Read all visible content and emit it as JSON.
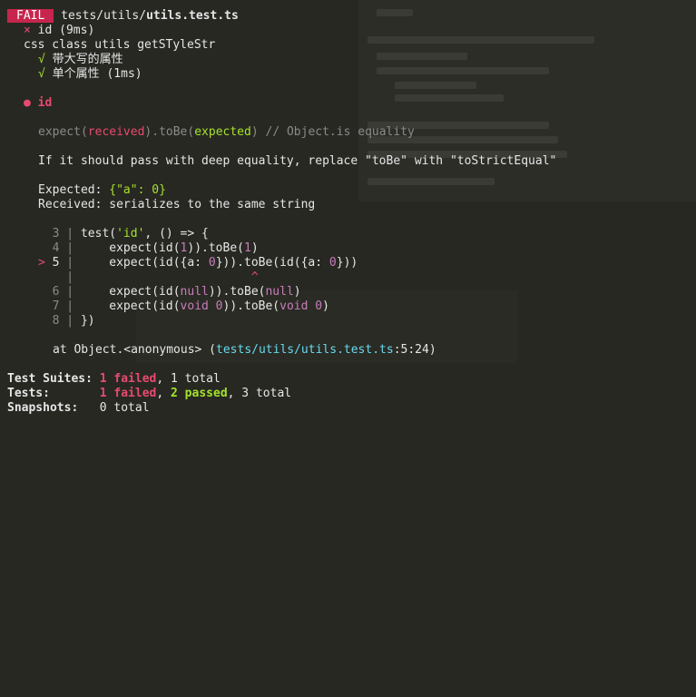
{
  "header": {
    "badge": "FAIL",
    "path_dir": "tests/utils/",
    "path_file": "utils.test.ts"
  },
  "tests": {
    "failed_mark": "×",
    "failed_name": "id (9ms)",
    "suite_name": "css class utils getSTyleStr",
    "pass_mark": "√",
    "passed": [
      "带大写的属性",
      "单个属性 (1ms)"
    ]
  },
  "error": {
    "bullet": "●",
    "title": "id",
    "expect_prefix": "expect(",
    "received_word": "received",
    "mid": ").toBe(",
    "expected_word": "expected",
    "suffix": ") // Object.is equality",
    "hint": "If it should pass with deep equality, replace \"toBe\" with \"toStrictEqual\"",
    "expected_label": "Expected: ",
    "expected_value": "{\"a\": 0}",
    "received_label": "Received: ",
    "received_value": "serializes to the same string"
  },
  "code": {
    "marker": ">",
    "line3_no": "3",
    "line3_a": "test(",
    "line3_str": "'id'",
    "line3_b": ", () => {",
    "line4_no": "4",
    "line4_a": "    expect(id(",
    "line4_num": "1",
    "line4_b": ")).toBe(",
    "line4_num2": "1",
    "line4_c": ")",
    "line5_no": "5",
    "line5_a": "    expect(id({a: ",
    "line5_num": "0",
    "line5_b": "})).toBe(id({a: ",
    "line5_num2": "0",
    "line5_c": "}))",
    "caret": "^",
    "line6_no": "6",
    "line6_a": "    expect(id(",
    "line6_kw": "null",
    "line6_b": ")).toBe(",
    "line6_kw2": "null",
    "line6_c": ")",
    "line7_no": "7",
    "line7_a": "    expect(id(",
    "line7_kw": "void",
    "line7_num": " 0",
    "line7_b": ")).toBe(",
    "line7_kw2": "void",
    "line7_num2": " 0",
    "line7_c": ")",
    "line8_no": "8",
    "line8_a": "})"
  },
  "stack": {
    "prefix": "at Object.<anonymous> (",
    "path": "tests/utils/utils.test.ts",
    "pos": ":5:24",
    "suffix": ")"
  },
  "summary": {
    "suites_label": "Test Suites: ",
    "suites_failed": "1 failed",
    "suites_rest": ", 1 total",
    "tests_label": "Tests:       ",
    "tests_failed": "1 failed",
    "tests_sep": ", ",
    "tests_passed": "2 passed",
    "tests_rest": ", 3 total",
    "snap_label": "Snapshots:   ",
    "snap_rest": "0 total"
  },
  "colors": {
    "background": "#272822",
    "fail_badge": "#c7254e",
    "fail_text": "#e84a6f",
    "pass_text": "#a6e22e",
    "keyword": "#c77dbb",
    "path": "#66d9ef"
  }
}
